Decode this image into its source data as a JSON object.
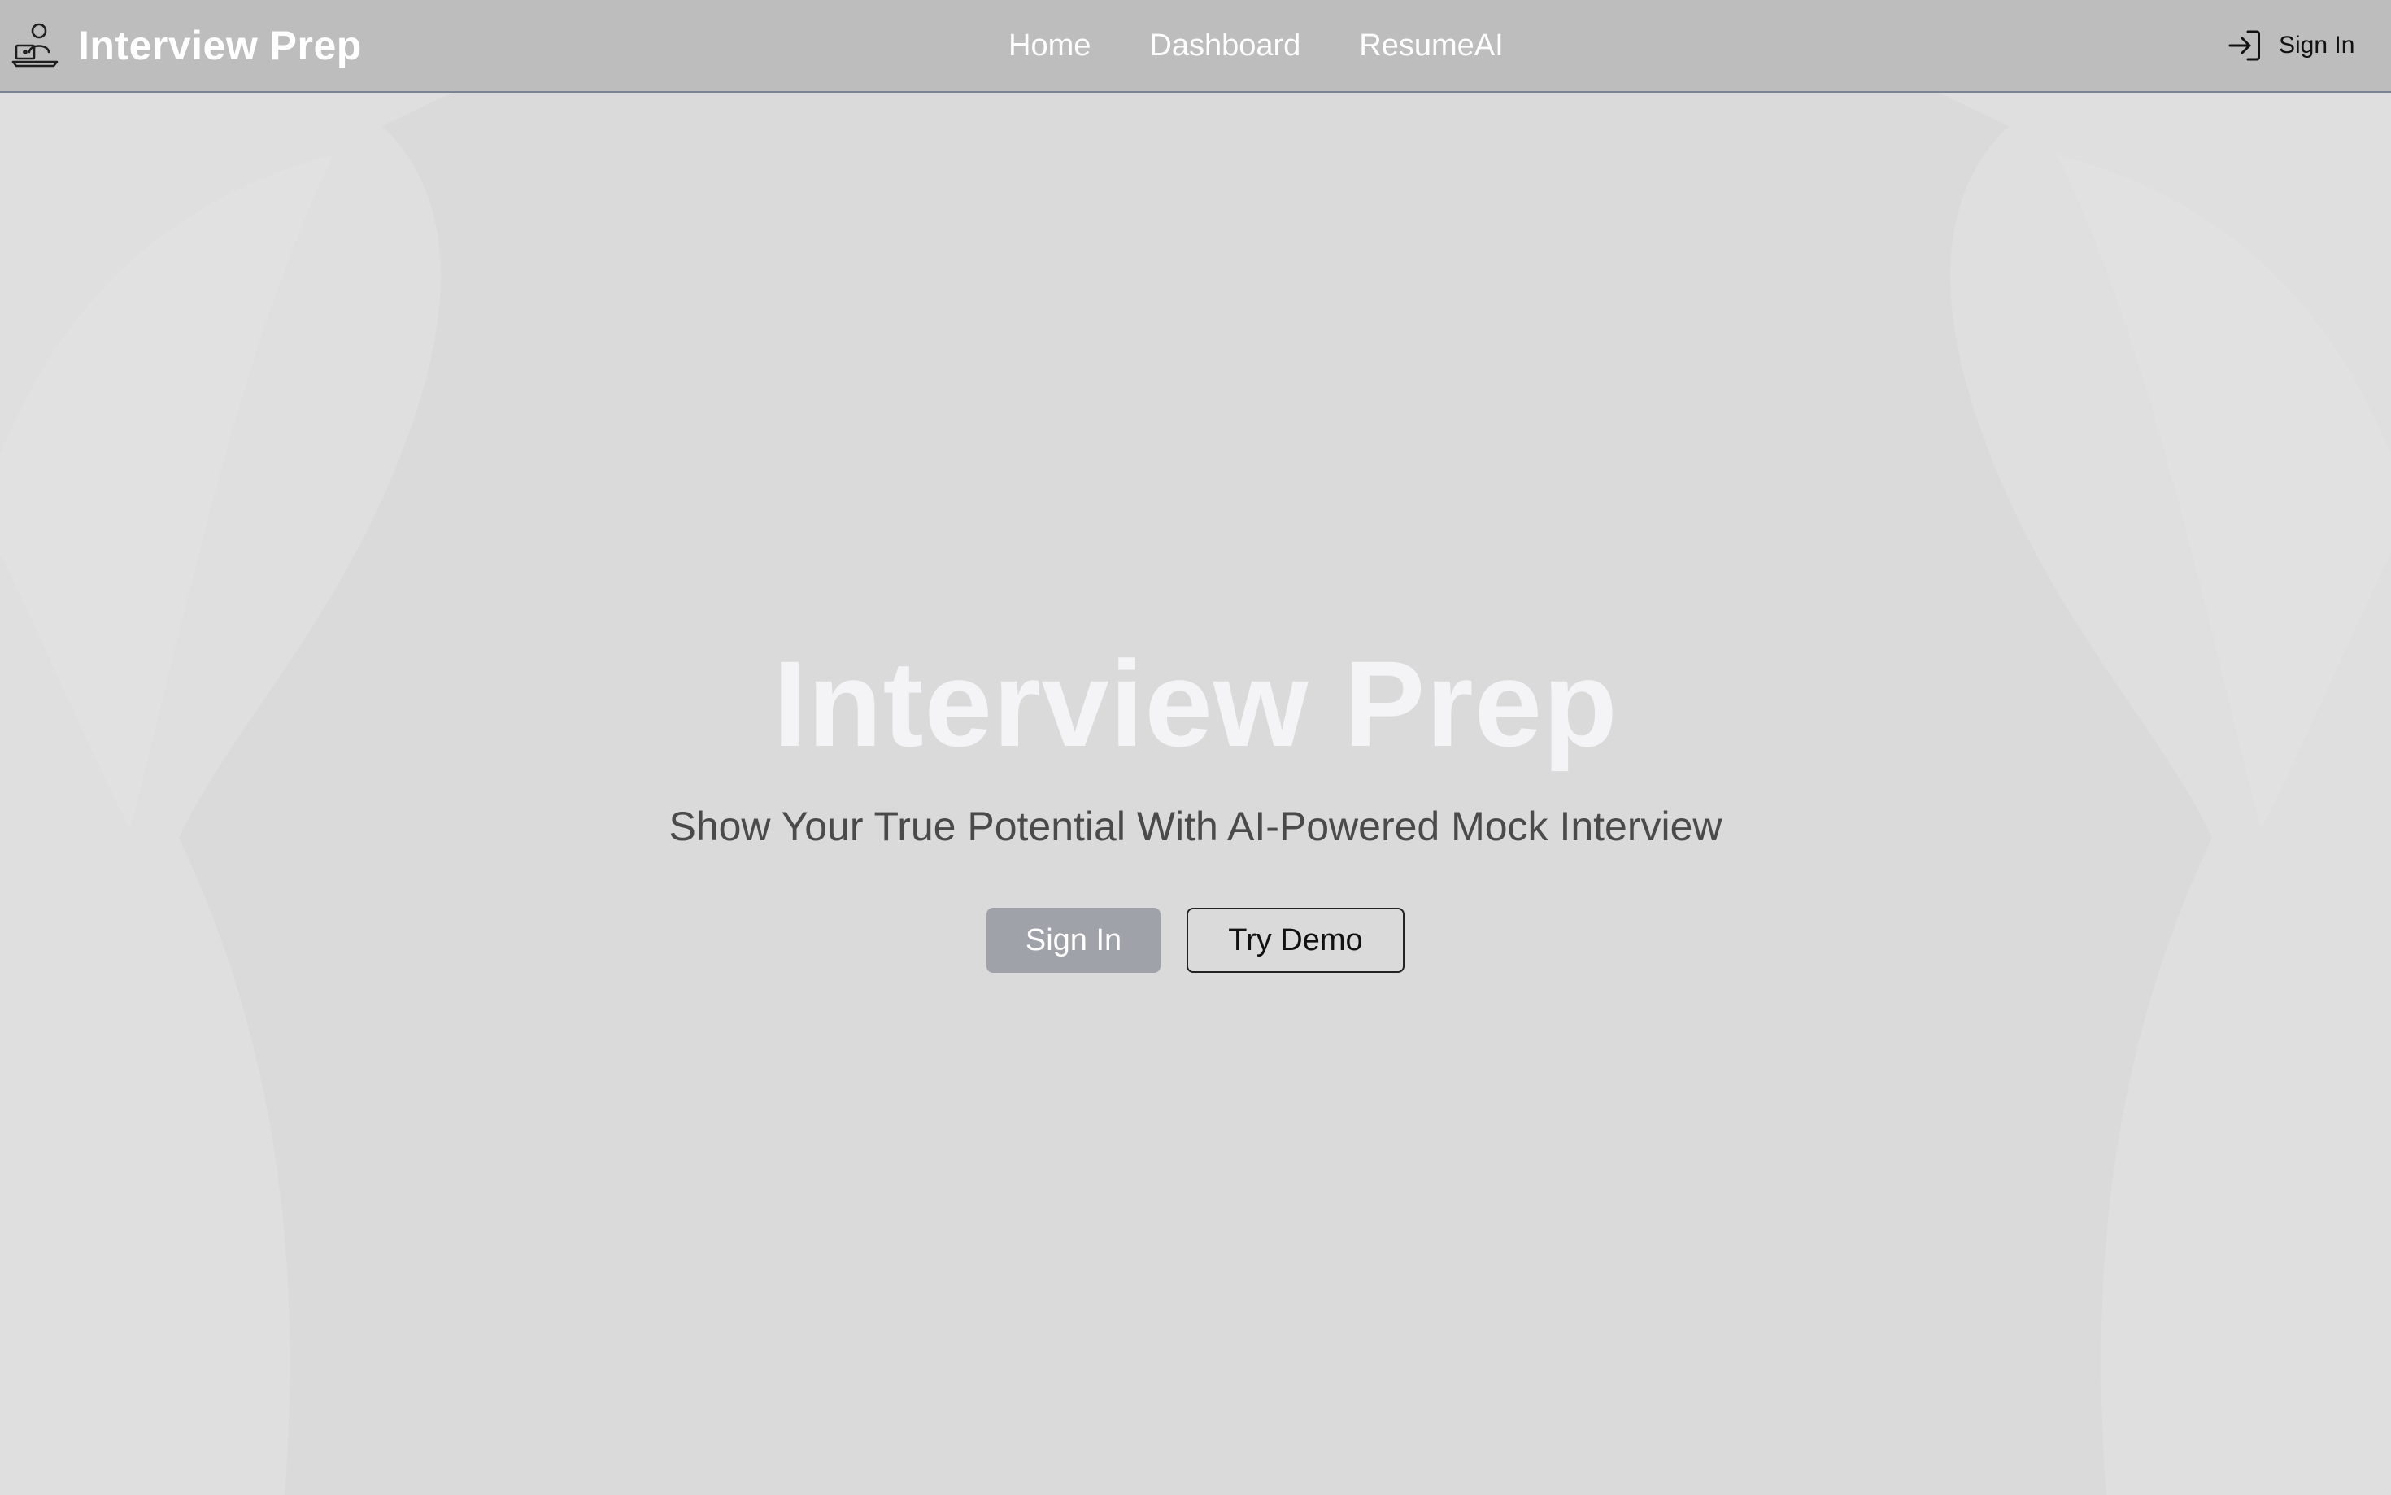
{
  "header": {
    "brand_icon": "interview-user-laptop-icon",
    "brand_title": "Interview Prep",
    "nav": [
      {
        "label": "Home"
      },
      {
        "label": "Dashboard"
      },
      {
        "label": "ResumeAI"
      }
    ],
    "signin_icon": "sign-in-arrow-icon",
    "signin_label": "Sign In"
  },
  "hero": {
    "title": "Interview Prep",
    "subtitle": "Show Your True Potential With AI-Powered Mock Interview",
    "primary_button": "Sign In",
    "secondary_button": "Try Demo"
  },
  "colors": {
    "background": "#dadada",
    "navbar": "#bdbdbd",
    "primary_button": "#9fa2a9",
    "title_text": "#f4f4f6"
  }
}
